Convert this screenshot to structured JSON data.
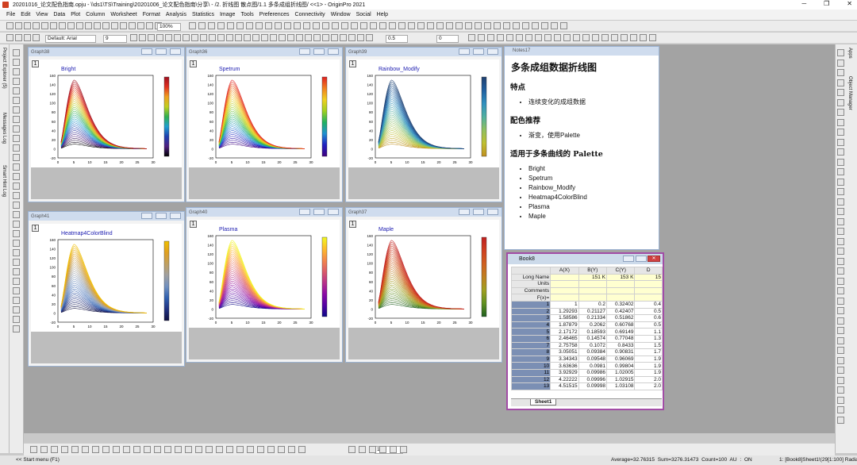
{
  "window": {
    "title": "20201016_论文配色指南.opju - \\\\ds1\\TS\\Training\\20201006_论文配色指南\\分享\\ - /2. 折线图 散点图/1.1 多条成组折线图/ <<1> - OriginPro 2021",
    "min": "─",
    "max": "❐",
    "close": "✕"
  },
  "menu": [
    "File",
    "Edit",
    "View",
    "Data",
    "Plot",
    "Column",
    "Worksheet",
    "Format",
    "Analysis",
    "Statistics",
    "Image",
    "Tools",
    "Preferences",
    "Connectivity",
    "Window",
    "Social",
    "Help"
  ],
  "toolbar": {
    "zoom": "100%",
    "font": "Default: Arial",
    "font_size": "9",
    "line_width": "0.5",
    "grid_value": "0",
    "bottom_size": "10"
  },
  "side_tabs": {
    "left": [
      "Project Explorer (5)",
      "Messages Log",
      "Smart Hint Log"
    ],
    "right": [
      "Apps",
      "Object Manager"
    ]
  },
  "graph_axes": {
    "y": [
      "160",
      "140",
      "120",
      "100",
      "80",
      "60",
      "40",
      "20",
      "0",
      "-20"
    ],
    "x": [
      "0",
      "5",
      "10",
      "15",
      "20",
      "25",
      "30"
    ]
  },
  "graphs": [
    {
      "win": "Graph38",
      "name": "Bright",
      "layer": "1",
      "colors": [
        "#000000",
        "#4f1f80",
        "#1f3fb0",
        "#1fa0d0",
        "#2fb04f",
        "#c0d020",
        "#f0a020",
        "#e03020",
        "#a01020"
      ]
    },
    {
      "win": "Graph36",
      "name": "Spetrum",
      "layer": "1",
      "colors": [
        "#3f007f",
        "#2020c0",
        "#2090d0",
        "#20b060",
        "#a0d020",
        "#f0d020",
        "#f08020",
        "#e02020"
      ]
    },
    {
      "win": "Graph39",
      "name": "Rainbow_Modify",
      "layer": "1",
      "colors": [
        "#c09020",
        "#c0c030",
        "#90c060",
        "#50b0a0",
        "#3090c0",
        "#2060a0",
        "#204070"
      ]
    },
    {
      "win": "Graph41",
      "name": "Heatmap4ColorBlind",
      "layer": "1",
      "colors": [
        "#101040",
        "#203080",
        "#3060b0",
        "#7090c0",
        "#a0a0a0",
        "#c0a060",
        "#e0a020",
        "#f0c000"
      ]
    },
    {
      "win": "Graph40",
      "name": "Plasma",
      "layer": "1",
      "colors": [
        "#0d0887",
        "#5302a3",
        "#8b0aa5",
        "#b83289",
        "#db5c68",
        "#f48849",
        "#febd2a",
        "#f0f921"
      ]
    },
    {
      "win": "Graph37",
      "name": "Maple",
      "layer": "1",
      "colors": [
        "#206020",
        "#609020",
        "#a0a020",
        "#c08020",
        "#d06020",
        "#d04020",
        "#c02020"
      ]
    }
  ],
  "notes": {
    "win": "Notes17",
    "h1": "多条成组数据折线图",
    "s1": "特点",
    "s1_items": [
      "连续变化的成组数据"
    ],
    "s2": "配色推荐",
    "s2_items": [
      "渐变，使用Palette"
    ],
    "s3": "适用于多条曲线的 Palette",
    "s3_items": [
      "Bright",
      "Spetrum",
      "Rainbow_Modify",
      "Heatmap4ColorBlind",
      "Plasma",
      "Maple"
    ]
  },
  "book": {
    "title": "Book8",
    "columns": [
      "A(X)",
      "B(Y)",
      "C(Y)",
      "D"
    ],
    "meta": [
      {
        "label": "Long Name",
        "vals": [
          "",
          "151 K",
          "153 K",
          "15"
        ]
      },
      {
        "label": "Units",
        "vals": [
          "",
          "",
          "",
          ""
        ]
      },
      {
        "label": "Comments",
        "vals": [
          "",
          "",
          "",
          ""
        ]
      },
      {
        "label": "F(x)=",
        "vals": [
          "",
          "",
          "",
          ""
        ]
      }
    ],
    "rows": [
      [
        "1",
        "1",
        "0.2",
        "0.32402",
        "0.4"
      ],
      [
        "2",
        "1.29293",
        "0.21127",
        "0.42407",
        "0.5"
      ],
      [
        "3",
        "1.58586",
        "0.21334",
        "0.51862",
        "0.6"
      ],
      [
        "4",
        "1.87879",
        "0.2062",
        "0.60768",
        "0.5"
      ],
      [
        "5",
        "2.17172",
        "0.18593",
        "0.69149",
        "1.1"
      ],
      [
        "6",
        "2.46465",
        "0.14574",
        "0.77048",
        "1.3"
      ],
      [
        "7",
        "2.75758",
        "0.1072",
        "0.8433",
        "1.5"
      ],
      [
        "8",
        "3.05051",
        "0.09384",
        "0.90831",
        "1.7"
      ],
      [
        "9",
        "3.34343",
        "0.09548",
        "0.96069",
        "1.9"
      ],
      [
        "10",
        "3.63636",
        "0.0981",
        "0.99804",
        "1.9"
      ],
      [
        "11",
        "3.92929",
        "0.09986",
        "1.02005",
        "1.9"
      ],
      [
        "12",
        "4.22222",
        "0.09996",
        "1.02915",
        "2.0"
      ],
      [
        "13",
        "4.51515",
        "0.09998",
        "1.03108",
        "2.0"
      ]
    ],
    "sheet": "Sheet1"
  },
  "status": {
    "start": "<< Start menu (F1)",
    "stats": "Average=32.76315  Sum=3276.31473  Count=100   AU : ON",
    "ref": "1: [Book8]Sheet1!(29[1:100]  Radian"
  }
}
